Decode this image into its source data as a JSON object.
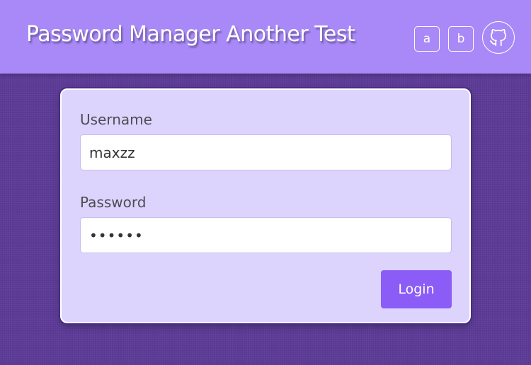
{
  "header": {
    "title": "Password Manager Another Test",
    "button_a_label": "a",
    "button_b_label": "b",
    "github_icon": "github-icon"
  },
  "form": {
    "username_label": "Username",
    "username_value": "maxzz",
    "password_label": "Password",
    "password_value": "••••••",
    "login_label": "Login"
  },
  "colors": {
    "header_bg": "#a889f7",
    "page_bg": "#5b3a96",
    "card_bg": "#dcd4fc",
    "accent": "#8b5cf6"
  }
}
